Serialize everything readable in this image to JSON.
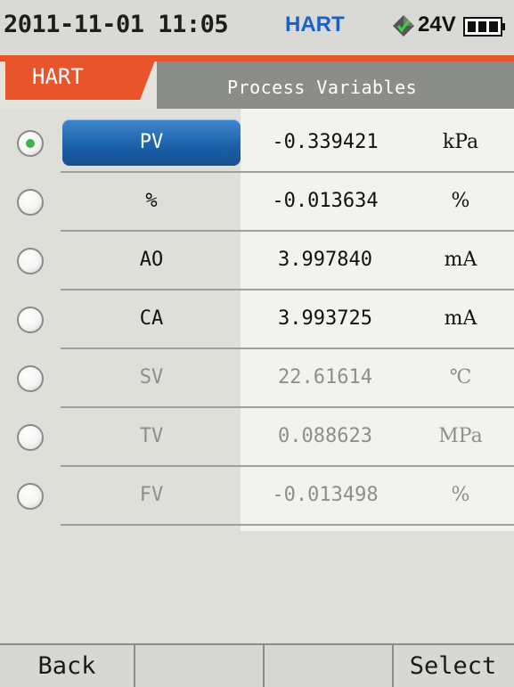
{
  "status": {
    "datetime": "2011-11-01 11:05",
    "protocol": "HART",
    "voltage": "24V",
    "accent_color": "#1c5fc8"
  },
  "header": {
    "tab_label": "HART",
    "title": "Process Variables",
    "tab_color": "#e8552a"
  },
  "variables": [
    {
      "name": "PV",
      "value": "-0.339421",
      "unit": "kPa",
      "selected": true,
      "enabled": true
    },
    {
      "name": "%",
      "value": "-0.013634",
      "unit": "%",
      "selected": false,
      "enabled": true
    },
    {
      "name": "AO",
      "value": "3.997840",
      "unit": "mA",
      "selected": false,
      "enabled": true
    },
    {
      "name": "CA",
      "value": "3.993725",
      "unit": "mA",
      "selected": false,
      "enabled": true
    },
    {
      "name": "SV",
      "value": "22.61614",
      "unit": "℃",
      "selected": false,
      "enabled": false
    },
    {
      "name": "TV",
      "value": "0.088623",
      "unit": "MPa",
      "selected": false,
      "enabled": false
    },
    {
      "name": "FV",
      "value": "-0.013498",
      "unit": "%",
      "selected": false,
      "enabled": false
    }
  ],
  "softkeys": [
    "Back",
    "",
    "",
    "Select"
  ],
  "icons": {
    "power_source": "power-diamond-icon",
    "battery": "battery-icon",
    "radio_selected_color": "#39b54a"
  }
}
